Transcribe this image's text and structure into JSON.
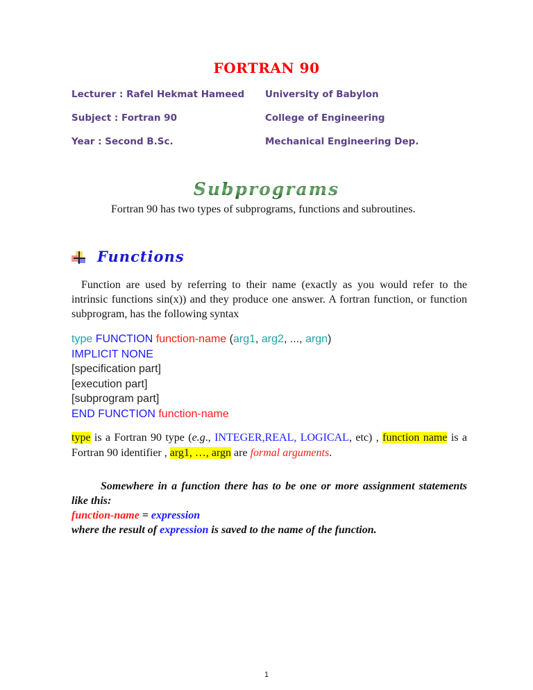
{
  "title": "FORTRAN 90",
  "header": {
    "left": [
      "Lecturer : Rafel Hekmat Hameed",
      "Subject : Fortran 90",
      "Year : Second B.Sc."
    ],
    "right": [
      "University of Babylon",
      "College of Engineering",
      "Mechanical Engineering Dep."
    ]
  },
  "section_title": "Subprograms",
  "intro": "Fortran 90 has two types of subprograms, functions and subroutines.",
  "functions": {
    "heading": "Functions",
    "bullet_icon": "plus-bullet-icon",
    "paragraph": "Function are used by referring to their name (exactly as you would refer to the intrinsic functions sin(x)) and they produce one answer. A fortran function, or function subprogram, has the following syntax",
    "syntax": {
      "line1": {
        "type": "type",
        "keyword": "FUNCTION",
        "name": "function-name",
        "open": " (",
        "arg1": "arg1",
        "sep1": ", ",
        "arg2": "arg2",
        "sep2": ", ..., ",
        "argn": "argn",
        "close": ")"
      },
      "line2": "IMPLICIT NONE",
      "line3": "[specification part]",
      "line4": "[execution part]",
      "line5": "[subprogram part]",
      "line6": {
        "keyword": "END FUNCTION",
        "name": "function-name"
      }
    },
    "description": {
      "t1": "type",
      "t2": " is a Fortran 90 type (",
      "t3": "e.g",
      "t4": "., ",
      "t5": "INTEGER,REAL, LOGICAL",
      "t6": ", etc)  , ",
      "t7": "function name",
      "t8": " is a Fortran 90 identifier , ",
      "t9": "arg1, …, argn",
      "t10": " are ",
      "t11": "formal arguments",
      "t12": "."
    },
    "note": {
      "line1": "Somewhere in a function there has to be one or more assignment statements like this:",
      "assign_name": "function-name",
      "assign_eq": " = ",
      "assign_expr": "expression",
      "line3a": "where the result of ",
      "line3b": "expression",
      "line3c": " is saved to the name of the function."
    }
  },
  "page_number": "1"
}
